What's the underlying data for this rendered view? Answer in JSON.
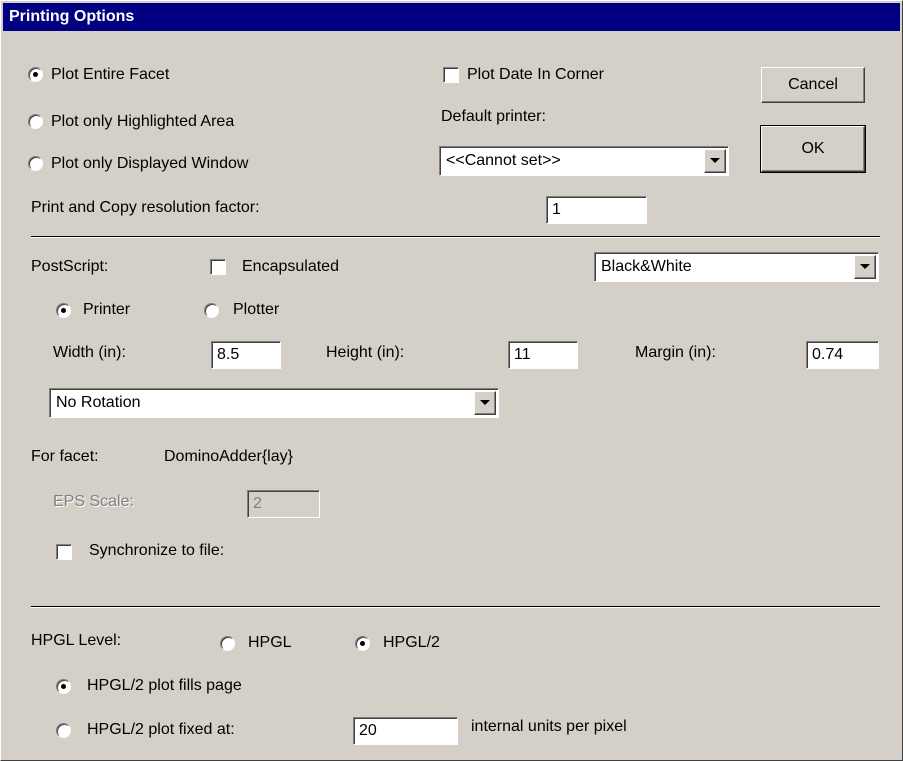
{
  "window": {
    "title": "Printing Options"
  },
  "plot_area": {
    "options": [
      {
        "label": "Plot Entire Facet",
        "selected": true
      },
      {
        "label": "Plot only Highlighted Area",
        "selected": false
      },
      {
        "label": "Plot only Displayed Window",
        "selected": false
      }
    ],
    "plot_date_label": "Plot Date In Corner",
    "plot_date_checked": false,
    "default_printer_label": "Default printer:",
    "default_printer_value": "<<Cannot set>>",
    "resolution_label": "Print and Copy resolution factor:",
    "resolution_value": "1"
  },
  "buttons": {
    "cancel": "Cancel",
    "ok": "OK"
  },
  "postscript": {
    "label": "PostScript:",
    "encapsulated_label": "Encapsulated",
    "encapsulated_checked": false,
    "color_mode": "Black&White",
    "printer_label": "Printer",
    "plotter_label": "Plotter",
    "output_selected": "Printer",
    "width_label": "Width (in):",
    "width_value": "8.5",
    "height_label": "Height (in):",
    "height_value": "11",
    "margin_label": "Margin (in):",
    "margin_value": "0.74",
    "rotation_value": "No Rotation",
    "facet_label": "For facet:",
    "facet_value": "DominoAdder{lay}",
    "eps_scale_label": "EPS Scale:",
    "eps_scale_value": "2",
    "sync_label": "Synchronize to file:",
    "sync_checked": false
  },
  "hpgl": {
    "level_label": "HPGL Level:",
    "hpgl_label": "HPGL",
    "hpgl2_label": "HPGL/2",
    "level_selected": "HPGL/2",
    "fills_page_label": "HPGL/2 plot fills page",
    "fixed_at_label": "HPGL/2 plot fixed at:",
    "scale_mode_selected": "fills_page",
    "fixed_value": "20",
    "units_label": "internal units per pixel"
  },
  "colors": {
    "titlebar": "#000080",
    "face": "#d4d0c8"
  }
}
